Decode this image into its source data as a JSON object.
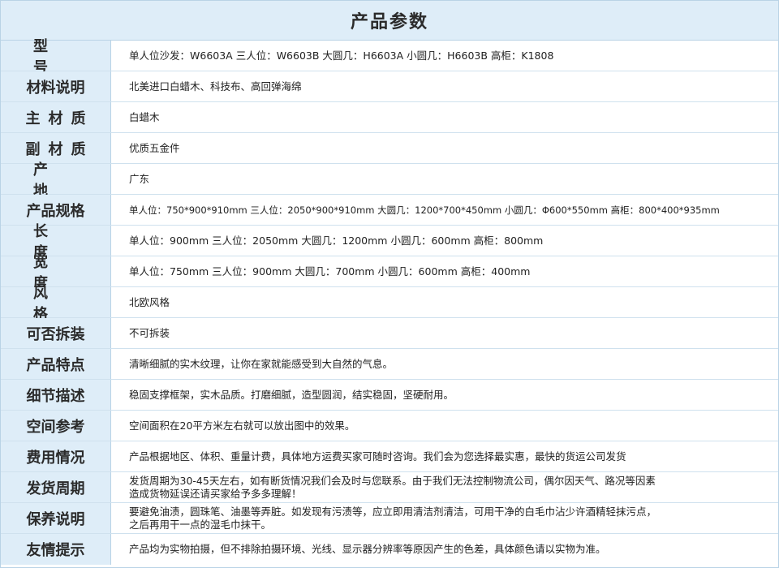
{
  "title": "产品参数",
  "rows": [
    {
      "label": "型号",
      "value": "单人位沙发：W6603A  三人位：W6603B    大圆几：H6603A  小圆几：H6603B  高柜：K1808"
    },
    {
      "label": "材料说明",
      "value": "北美进口白蜡木、科技布、高回弹海绵"
    },
    {
      "label": "主材质",
      "value": "白蜡木"
    },
    {
      "label": "副材质",
      "value": "优质五金件"
    },
    {
      "label": "产地",
      "value": "广东"
    },
    {
      "label": "产品规格",
      "value": "单人位：750*900*910mm    三人位：2050*900*910mm   大圆几：1200*700*450mm   小圆几：Φ600*550mm   高柜：800*400*935mm"
    },
    {
      "label": "长度",
      "value": "单人位：900mm    三人位：2050mm   大圆几：1200mm   小圆几：600mm   高柜：800mm"
    },
    {
      "label": "宽度",
      "value": "单人位：750mm     三人位：900mm   大圆几：700mm   小圆几：600mm   高柜：400mm"
    },
    {
      "label": "风格",
      "value": "北欧风格"
    },
    {
      "label": "可否拆装",
      "value": "不可拆装"
    },
    {
      "label": "产品特点",
      "value": "清晰细腻的实木纹理，让你在家就能感受到大自然的气息。"
    },
    {
      "label": "细节描述",
      "value": "稳固支撑框架，实木品质。打磨细腻，造型圆润，结实稳固，坚硬耐用。"
    },
    {
      "label": "空间参考",
      "value": "空间面积在20平方米左右就可以放出图中的效果。"
    },
    {
      "label": "费用情况",
      "value": "产品根据地区、体积、重量计费，具体地方运费买家可随时咨询。我们会为您选择最实惠，最快的货运公司发货"
    },
    {
      "label": "发货周期",
      "value": "发货周期为30-45天左右，如有断货情况我们会及时与您联系。由于我们无法控制物流公司，偶尔因天气、路况等因素\n造成货物延误还请买家给予多多理解！"
    },
    {
      "label": "保养说明",
      "value": "要避免油渍，圆珠笔、油墨等弄脏。如发现有污渍等，应立即用清洁剂清洁，可用干净的白毛巾沾少许酒精轻抹污点，\n之后再用干一点的湿毛巾抹干。"
    },
    {
      "label": "友情提示",
      "value": "产品均为实物拍摄，但不排除拍摄环境、光线、显示器分辨率等原因产生的色差，具体颜色请以实物为准。"
    }
  ]
}
